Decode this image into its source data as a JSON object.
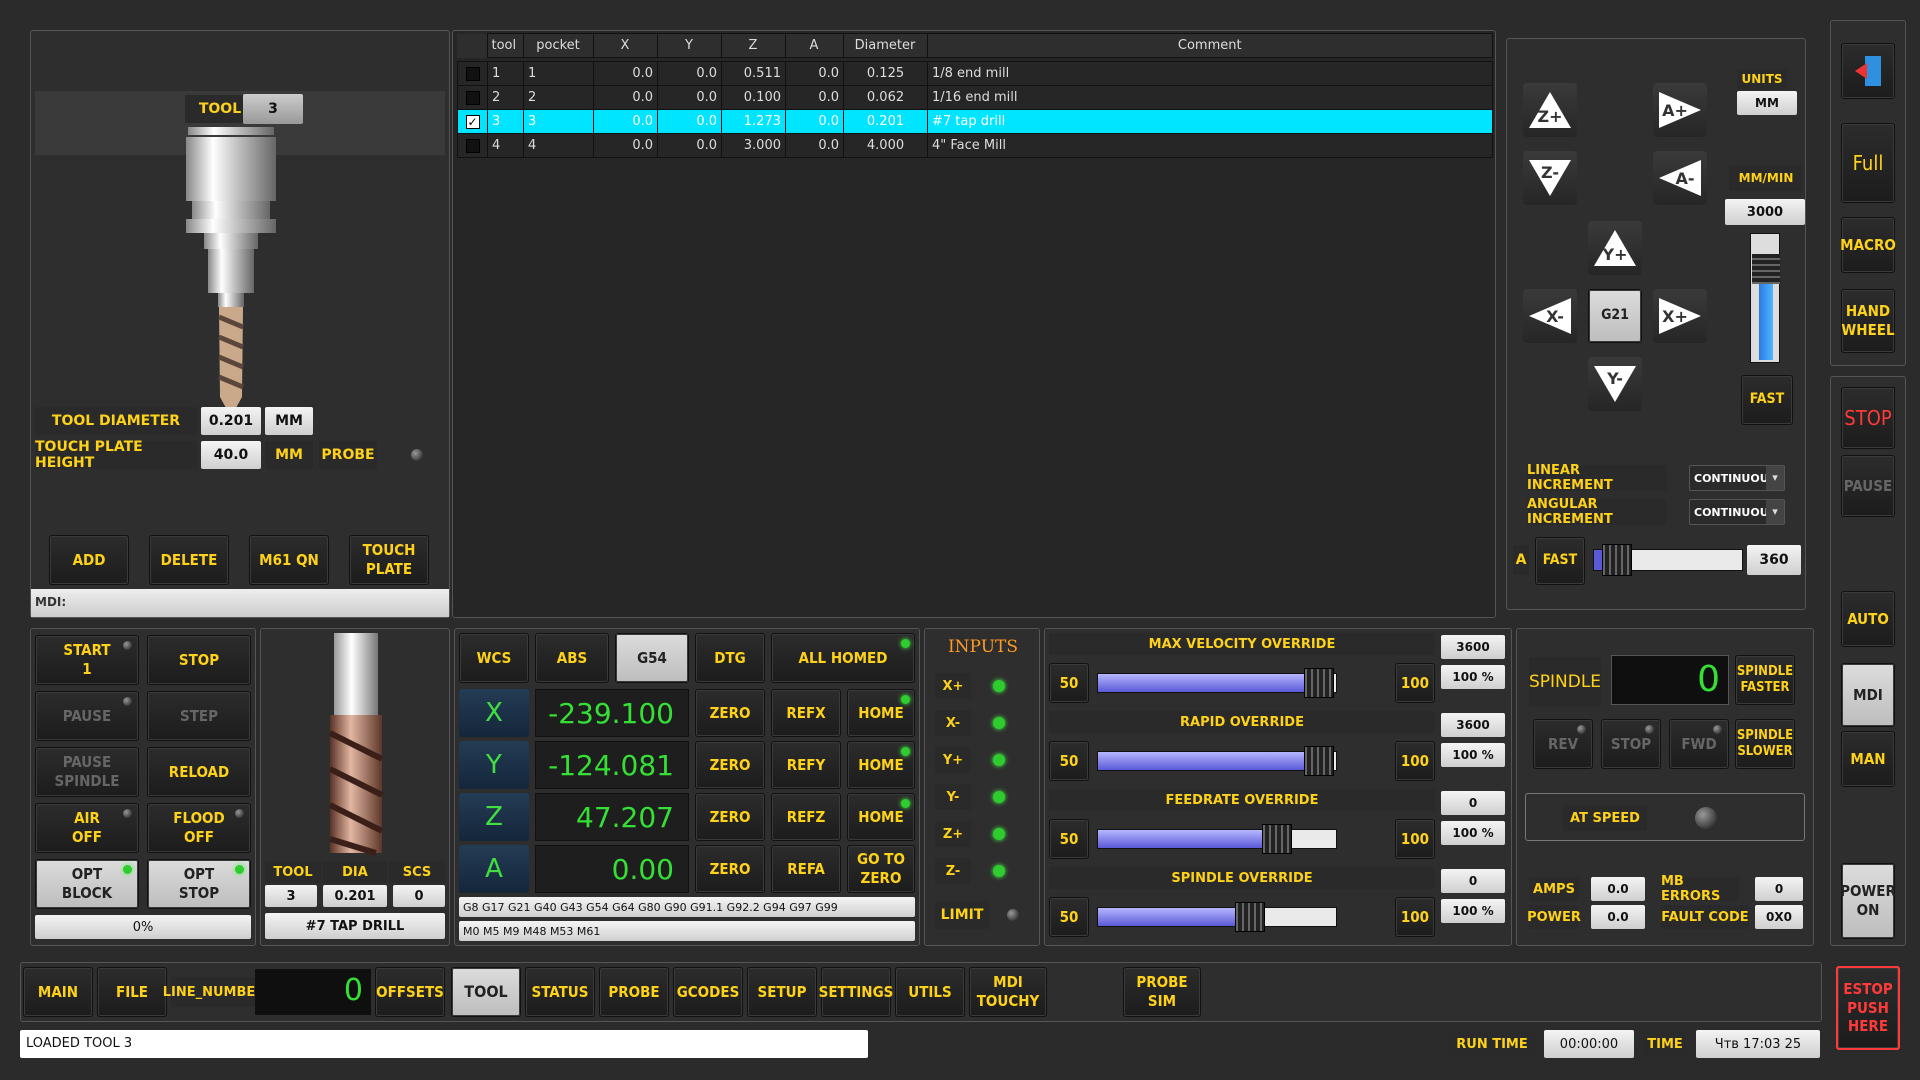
{
  "tool_panel": {
    "tool_label": "TOOL",
    "tool_number": "3",
    "tool_diameter_label": "TOOL DIAMETER",
    "tool_diameter": "0.201",
    "diam_units": "MM",
    "touch_plate_label": "TOUCH PLATE HEIGHT",
    "touch_plate_height": "40.0",
    "touch_units": "MM",
    "probe_label": "PROBE",
    "buttons": [
      "ADD",
      "DELETE",
      "M61 QN",
      "TOUCH\nPLATE"
    ],
    "mdi_label": "MDI:"
  },
  "tool_table": {
    "headers": [
      "tool",
      "pocket",
      "X",
      "Y",
      "Z",
      "A",
      "Diameter",
      "Comment"
    ],
    "rows": [
      [
        "1",
        "1",
        "0.0",
        "0.0",
        "0.511",
        "0.0",
        "0.125",
        "1/8 end mill"
      ],
      [
        "2",
        "2",
        "0.0",
        "0.0",
        "0.100",
        "0.0",
        "0.062",
        "1/16 end mill"
      ],
      [
        "3",
        "3",
        "0.0",
        "0.0",
        "1.273",
        "0.0",
        "0.201",
        "#7 tap drill"
      ],
      [
        "4",
        "4",
        "0.0",
        "0.0",
        "3.000",
        "0.0",
        "4.000",
        "4\" Face Mill"
      ]
    ],
    "selected_row": 2,
    "highlight_color": "#00e5ff"
  },
  "jog": {
    "buttons": [
      "Z+",
      "A+",
      "Z-",
      "A-",
      "Y+",
      "X-",
      "G21",
      "X+",
      "Y-"
    ],
    "units_label": "UNITS",
    "units": "MM",
    "rate_label": "MM/MIN",
    "rate": "3000",
    "fast": "FAST",
    "linear_increment_label": "LINEAR INCREMENT",
    "linear_increment": "CONTINUOUS",
    "angular_increment_label": "ANGULAR INCREMENT",
    "angular_increment": "CONTINUOUS",
    "a_label": "A",
    "a_fast": "FAST",
    "a_value": "360",
    "jog_level": 0.78
  },
  "side_top": {
    "full": "Full",
    "macro": "MACRO",
    "handwheel": "HAND\nWHEEL"
  },
  "side_bottom": {
    "stop": "STOP",
    "pause": "PAUSE",
    "auto": "AUTO",
    "mdi": "MDI",
    "man": "MAN",
    "power": "POWER\nON",
    "estop": "ESTOP\nPUSH\nHERE"
  },
  "program": {
    "start": "START\n1",
    "stop": "STOP",
    "pause": "PAUSE",
    "step": "STEP",
    "pause_spindle": "PAUSE\nSPINDLE",
    "reload": "RELOAD",
    "air": "AIR\nOFF",
    "flood": "FLOOD\nOFF",
    "opt_block": "OPT\nBLOCK",
    "opt_stop": "OPT\nSTOP",
    "progress": "0%"
  },
  "tool_info": {
    "labels": [
      "TOOL",
      "DIA",
      "SCS"
    ],
    "values": [
      "3",
      "0.201",
      "0"
    ],
    "name": "#7 TAP DRILL"
  },
  "dro": {
    "wcs": "WCS",
    "abs": "ABS",
    "g54": "G54",
    "dtg": "DTG",
    "homed": "ALL HOMED",
    "axes": [
      {
        "axis": "X",
        "value": "-239.100",
        "ref": "REFX",
        "home": "HOME"
      },
      {
        "axis": "Y",
        "value": "-124.081",
        "ref": "REFY",
        "home": "HOME"
      },
      {
        "axis": "Z",
        "value": "47.207",
        "ref": "REFZ",
        "home": "HOME"
      },
      {
        "axis": "A",
        "value": "0.00",
        "ref": "REFA",
        "home": "GO TO\nZERO"
      }
    ],
    "zero": "ZERO",
    "gcodes": "G8 G17 G21 G40 G43 G54 G64 G80 G90 G91.1 G92.2 G94 G97 G99",
    "mcodes": "M0 M5 M9 M48 M53 M61"
  },
  "inputs": {
    "title": "INPUTS",
    "items": [
      "X+",
      "X-",
      "Y+",
      "Y-",
      "Z+",
      "Z-"
    ],
    "limit": "LIMIT"
  },
  "overrides": [
    {
      "title": "MAX VELOCITY OVERRIDE",
      "value": "3600",
      "pct": "100 %",
      "level": 1.0
    },
    {
      "title": "RAPID OVERRIDE",
      "value": "3600",
      "pct": "100 %",
      "level": 1.0
    },
    {
      "title": "FEEDRATE OVERRIDE",
      "value": "0",
      "pct": "100 %",
      "level": 0.8
    },
    {
      "title": "SPINDLE OVERRIDE",
      "value": "0",
      "pct": "100 %",
      "level": 0.67
    }
  ],
  "override_min": "50",
  "override_max": "100",
  "spindle": {
    "label": "SPINDLE",
    "rpm": "0",
    "faster": "SPINDLE\nFASTER",
    "slower": "SPINDLE\nSLOWER",
    "rev": "REV",
    "stop": "STOP",
    "fwd": "FWD",
    "at_speed": "AT SPEED",
    "amps_label": "AMPS",
    "amps": "0.0",
    "mb_errors_label": "MB ERRORS",
    "mb_errors": "0",
    "power_label": "POWER",
    "power": "0.0",
    "fault_label": "FAULT CODE",
    "fault": "0X0"
  },
  "bottom_tabs": {
    "main": "MAIN",
    "file": "FILE",
    "line_label": "LINE_NUMBER",
    "line": "0",
    "offsets": "OFFSETS",
    "tool": "TOOL",
    "status": "STATUS",
    "probe": "PROBE",
    "gcodes": "GCODES",
    "setup": "SETUP",
    "settings": "SETTINGS",
    "utils": "UTILS",
    "mdi_touchy": "MDI\nTOUCHY",
    "probe_sim": "PROBE\nSIM"
  },
  "status_bar": {
    "message": "LOADED TOOL 3",
    "run_time_label": "RUN TIME",
    "run_time": "00:00:00",
    "time_label": "TIME",
    "time": "Чтв 17:03 25"
  }
}
